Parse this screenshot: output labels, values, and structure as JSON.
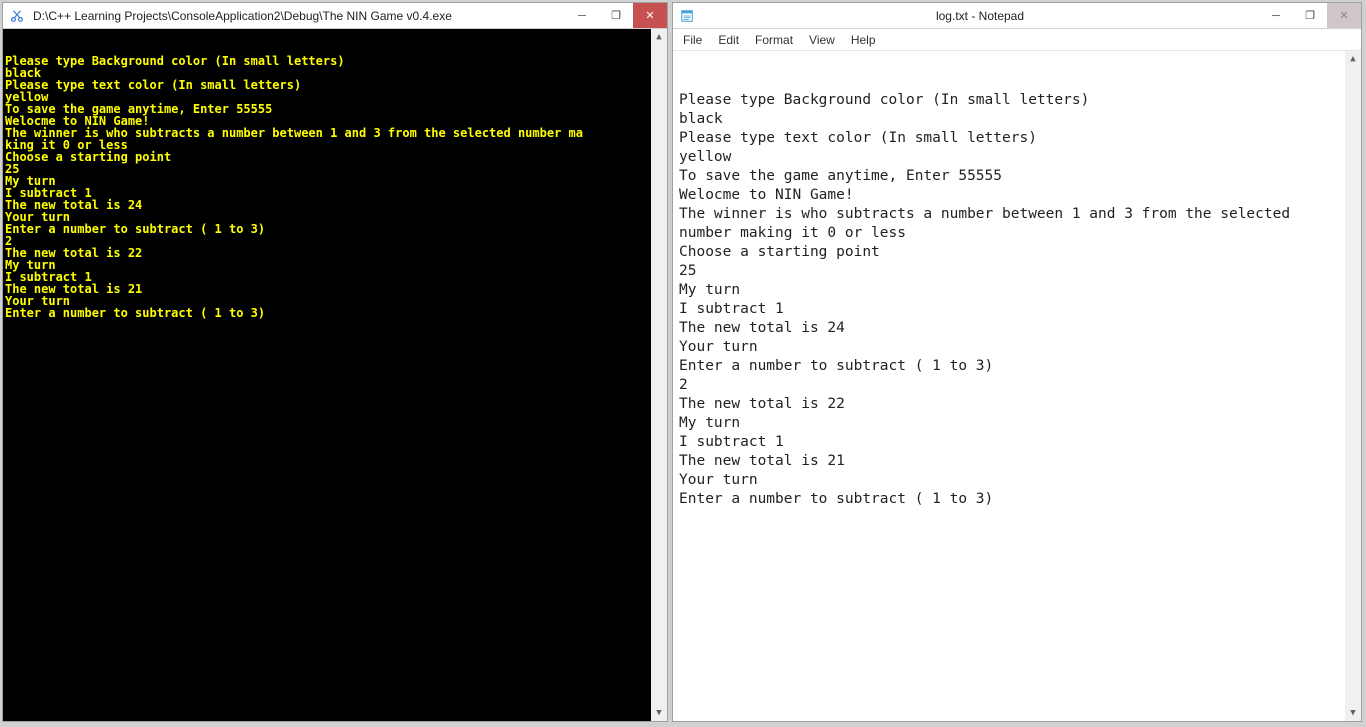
{
  "console": {
    "title": "D:\\C++ Learning Projects\\ConsoleApplication2\\Debug\\The NIN Game v0.4.exe",
    "icon": "cut-icon",
    "lines": [
      "Please type Background color (In small letters)",
      "black",
      "Please type text color (In small letters)",
      "yellow",
      "To save the game anytime, Enter 55555",
      "Welocme to NIN Game!",
      "The winner is who subtracts a number between 1 and 3 from the selected number ma",
      "king it 0 or less",
      "Choose a starting point",
      "25",
      "My turn",
      "I subtract 1",
      "The new total is 24",
      "Your turn",
      "Enter a number to subtract ( 1 to 3)",
      "2",
      "The new total is 22",
      "My turn",
      "I subtract 1",
      "The new total is 21",
      "Your turn",
      "Enter a number to subtract ( 1 to 3)"
    ]
  },
  "notepad": {
    "title": "log.txt - Notepad",
    "icon": "notepad-icon",
    "menu": {
      "file": "File",
      "edit": "Edit",
      "format": "Format",
      "view": "View",
      "help": "Help"
    },
    "content": "Please type Background color (In small letters)\nblack\nPlease type text color (In small letters)\nyellow\nTo save the game anytime, Enter 55555\nWelocme to NIN Game!\nThe winner is who subtracts a number between 1 and 3 from the selected number making it 0 or less\nChoose a starting point\n25\nMy turn\nI subtract 1\nThe new total is 24\nYour turn\nEnter a number to subtract ( 1 to 3)\n2\nThe new total is 22\nMy turn\nI subtract 1\nThe new total is 21\nYour turn\nEnter a number to subtract ( 1 to 3)"
  },
  "window_controls": {
    "minimize": "─",
    "maximize": "❐",
    "close": "✕"
  }
}
